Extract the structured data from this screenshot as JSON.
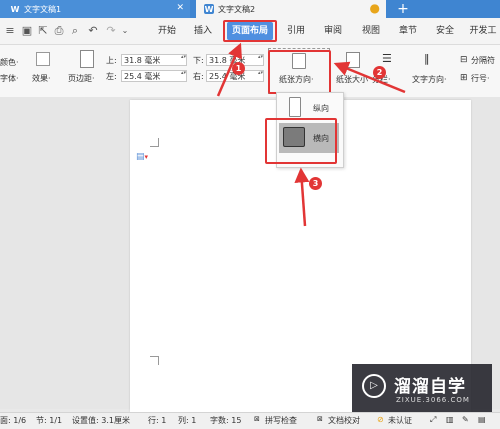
{
  "tabs": [
    {
      "label": "文字文稿1",
      "icon": "W"
    },
    {
      "label": "文字文稿2",
      "icon": "W"
    }
  ],
  "tab_add": "+",
  "menu": [
    "开始",
    "插入",
    "页面布局",
    "引用",
    "审阅",
    "视图",
    "章节",
    "安全",
    "开发工"
  ],
  "ribbon": {
    "color_label": "颜色·",
    "font_label": "字体·",
    "effect_label": "效果·",
    "margin_label": "页边距·",
    "top_label": "上:",
    "top_value": "31.8 毫米",
    "bottom_label": "下:",
    "bottom_value": "31.8 毫米",
    "left_label": "左:",
    "left_value": "25.4 毫米",
    "right_label": "右:",
    "right_value": "25.4 毫米",
    "orientation_label": "纸张方向·",
    "size_label": "纸张大小",
    "columns_label": "分栏·",
    "text_dir_label": "文字方向·",
    "breaks_label": "分隔符",
    "line_num_label": "行号·"
  },
  "dropdown": {
    "portrait": "纵向",
    "landscape": "横向"
  },
  "badges": [
    "1",
    "2",
    "3"
  ],
  "status": {
    "page": "面: 1/6",
    "section": "节: 1/1",
    "setting": "设置值: 3.1厘米",
    "row": "行: 1",
    "col": "列: 1",
    "words": "字数: 15",
    "spell": "拼写检查",
    "doc_check": "文档校对",
    "auth": "未认证"
  },
  "watermark": {
    "name": "溜溜自学",
    "url": "ZIXUE.3066.COM"
  },
  "colors": {
    "accent": "#3f85d1",
    "highlight": "#e23535"
  }
}
